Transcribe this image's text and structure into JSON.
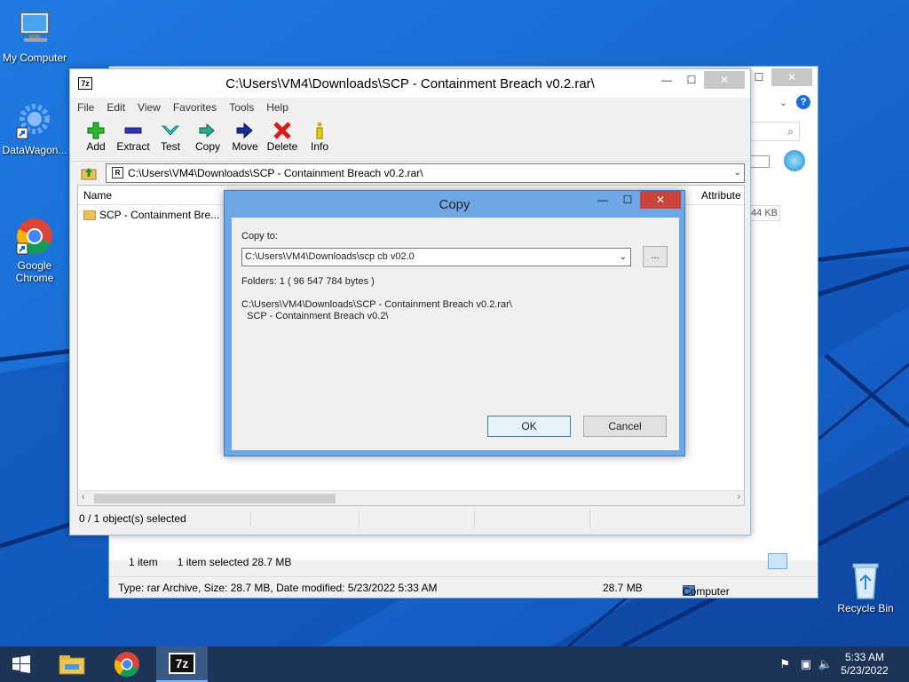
{
  "desktop": {
    "icons": [
      {
        "label": "My Computer"
      },
      {
        "label": "DataWagon..."
      },
      {
        "label": "Google\nChrome"
      },
      {
        "label": "Recycle Bin"
      }
    ]
  },
  "explorer": {
    "status_items": "1 item",
    "status_selected": "1 item selected  28.7 MB",
    "details": "Type: rar Archive, Size: 28.7 MB, Date modified: 5/23/2022 5:33 AM",
    "size": "28.7 MB",
    "location": "Computer",
    "size_col_fragment": "44 KB"
  },
  "sevenzip": {
    "app_icon": "7z",
    "title": "C:\\Users\\VM4\\Downloads\\SCP - Containment Breach v0.2.rar\\",
    "menu": [
      "File",
      "Edit",
      "View",
      "Favorites",
      "Tools",
      "Help"
    ],
    "toolbar": [
      "Add",
      "Extract",
      "Test",
      "Copy",
      "Move",
      "Delete",
      "Info"
    ],
    "address": "C:\\Users\\VM4\\Downloads\\SCP - Containment Breach v0.2.rar\\",
    "address_icon": "R",
    "columns": {
      "name": "Name",
      "attributes": "Attribute"
    },
    "rows": [
      {
        "name": "SCP - Containment Bre..."
      }
    ],
    "status": "0 / 1 object(s) selected"
  },
  "copy_dialog": {
    "title": "Copy",
    "copy_to_label": "Copy to:",
    "path_value": "C:\\Users\\VM4\\Downloads\\scp cb v02.0",
    "browse_label": "...",
    "folders_info": "Folders: 1    ( 96 547 784 bytes )",
    "source_line1": "C:\\Users\\VM4\\Downloads\\SCP - Containment Breach v0.2.rar\\",
    "source_line2": "  SCP - Containment Breach v0.2\\",
    "ok_label": "OK",
    "cancel_label": "Cancel"
  },
  "taskbar": {
    "time": "5:33 AM",
    "date": "5/23/2022",
    "sevenzip_label": "7z"
  }
}
